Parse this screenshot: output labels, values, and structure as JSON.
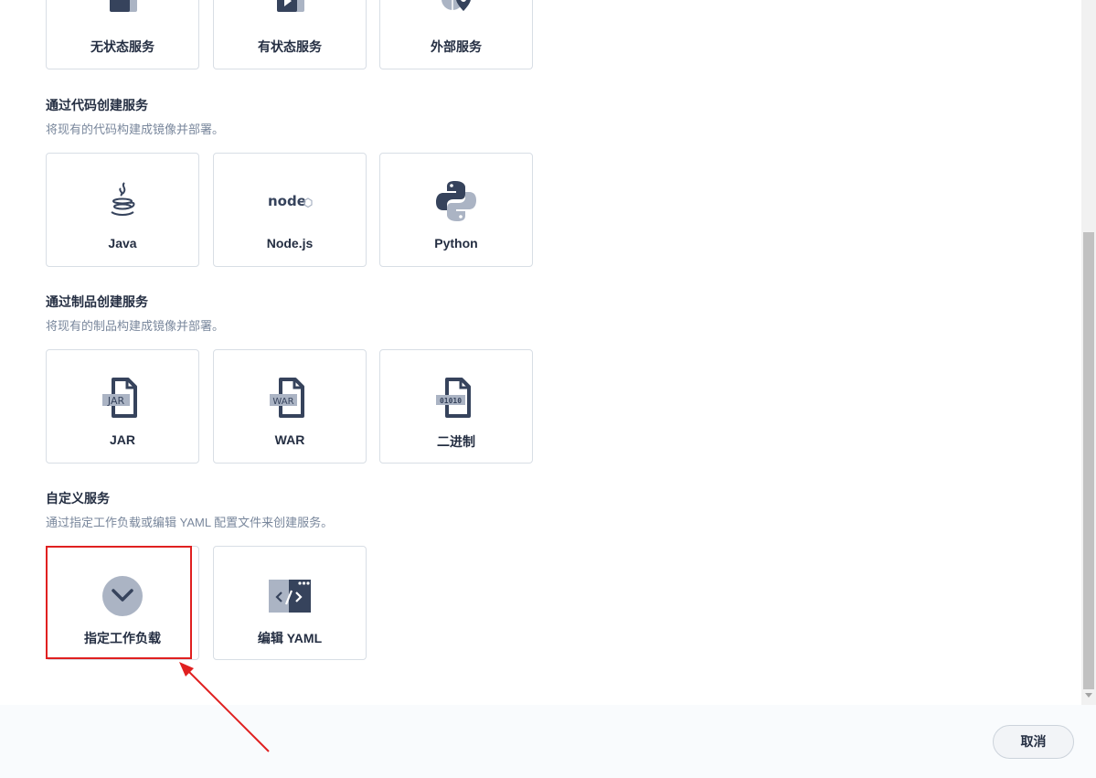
{
  "top_cards": [
    {
      "label": "无状态服务",
      "icon": "stateless-service-icon"
    },
    {
      "label": "有状态服务",
      "icon": "stateful-service-icon"
    },
    {
      "label": "外部服务",
      "icon": "external-service-icon"
    }
  ],
  "code_section": {
    "title": "通过代码创建服务",
    "description": "将现有的代码构建成镜像并部署。",
    "cards": [
      {
        "label": "Java",
        "icon": "java-icon"
      },
      {
        "label": "Node.js",
        "icon": "nodejs-icon"
      },
      {
        "label": "Python",
        "icon": "python-icon"
      }
    ]
  },
  "artifact_section": {
    "title": "通过制品创建服务",
    "description": "将现有的制品构建成镜像并部署。",
    "cards": [
      {
        "label": "JAR",
        "icon": "jar-file-icon",
        "icon_text": "JAR"
      },
      {
        "label": "WAR",
        "icon": "war-file-icon",
        "icon_text": "WAR"
      },
      {
        "label": "二进制",
        "icon": "binary-file-icon",
        "icon_text": "01010"
      }
    ]
  },
  "custom_section": {
    "title": "自定义服务",
    "description": "通过指定工作负载或编辑 YAML 配置文件来创建服务。",
    "cards": [
      {
        "label": "指定工作负载",
        "icon": "workload-check-icon"
      },
      {
        "label": "编辑 YAML",
        "icon": "yaml-code-icon"
      }
    ]
  },
  "footer": {
    "cancel_label": "取消"
  },
  "colors": {
    "accent_highlight": "#e02020",
    "icon_dark": "#36435c",
    "icon_light": "#abb4c4",
    "border": "#d8dee5"
  }
}
